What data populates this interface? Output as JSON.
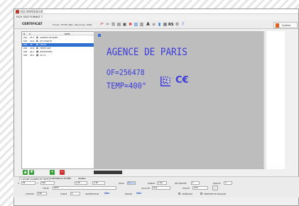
{
  "window": {
    "title": "IQS MARQUEUR",
    "menu": [
      "FICH",
      "EDIT",
      "FORMAT",
      "?"
    ]
  },
  "toolbar": {
    "title": "CERTIFICAT",
    "info": "Fichier: TEXTE_NB1 / Machines: IDEN",
    "exit_label": "Quitter",
    "icons": [
      "undo-icon",
      "cut-icon",
      "copy-icon",
      "paste-icon",
      "save-icon",
      "delete-icon",
      "image-icon",
      "barcode-icon",
      "text-icon",
      "list-icon",
      "align-icon",
      "grid-icon",
      "rs-icon",
      "settings-icon",
      "help-icon"
    ]
  },
  "tree": {
    "headers": [
      "N",
      "X",
      "",
      "DATA"
    ],
    "rows": [
      {
        "n": "001",
        "x": "25.7",
        "icon": "A",
        "label": "AGENCE DE PARIS",
        "selected": false
      },
      {
        "n": "002",
        "x": "30.6",
        "icon": "A",
        "label": "OF=256478",
        "selected": false
      },
      {
        "n": "003",
        "x": "38",
        "icon": "A",
        "label": "TEXTE",
        "selected": true
      },
      {
        "n": "004",
        "x": "40.6",
        "icon": "A",
        "label": "TEMP=400°",
        "selected": false
      },
      {
        "n": "005",
        "x": "46.1",
        "icon": "▦",
        "label": "DATAMATRIX",
        "selected": false
      },
      {
        "n": "006",
        "x": "46.0",
        "icon": "▦",
        "label": "CE Ico",
        "selected": false
      }
    ]
  },
  "label": {
    "line1": "AGENCE DE PARIS",
    "line2": "OF=256478",
    "line3": "TEMP=400°",
    "mark": "C€"
  },
  "bottom": {
    "tabs": [
      "A  CHAINE SCANNER DE TEXTE",
      "C  OPTIONS DU FICHIER",
      "Variable"
    ],
    "x_label": "X",
    "x_value": "50",
    "y_label": "Y",
    "y_value": "100",
    "x2_value": "1.06",
    "y2_value": "1.36",
    "prog_label": "PROG",
    "prog_value": "3",
    "rapide_label": "RAPIDE",
    "rapide_value": "1.00",
    "rec_label": "REC/RAPIDE",
    "rec_value": "1",
    "espace_label": "ESPACE",
    "espace_value": "3",
    "texte_label": "TEXTE",
    "texte_value": "TEXT",
    "qualite_label": "QUALITE",
    "qualite_value": "Fine",
    "police_label": "POLICE",
    "police_value": "COS",
    "vitesse_label": "VITESSE",
    "vitesse_value": "100",
    "force_label": "FORCE",
    "force_value": "1",
    "orientation_label": "ORIENTATION",
    "orientation_abc": "Abc",
    "miroir_label": "MIROIR",
    "miroir_abc": "Abc",
    "centrage_label": "CENTRAGE",
    "fenetre_label": "FENETRE DE PASSAGE"
  }
}
